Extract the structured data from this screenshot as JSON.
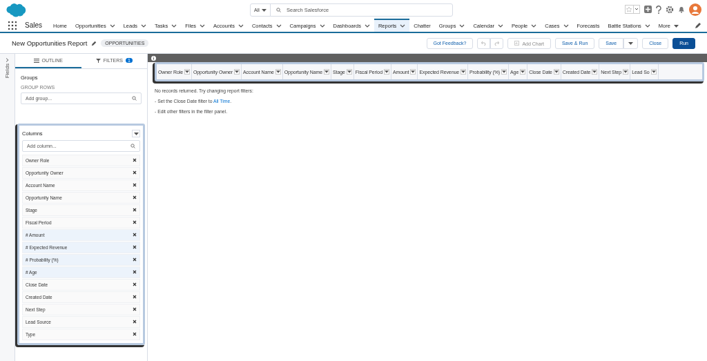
{
  "header": {
    "search_scope": "All",
    "search_placeholder": "Search Salesforce"
  },
  "nav": {
    "app_name": "Sales",
    "items": [
      {
        "label": "Home",
        "menu": false,
        "selected": false
      },
      {
        "label": "Opportunities",
        "menu": true,
        "selected": false
      },
      {
        "label": "Leads",
        "menu": true,
        "selected": false
      },
      {
        "label": "Tasks",
        "menu": true,
        "selected": false
      },
      {
        "label": "Files",
        "menu": true,
        "selected": false
      },
      {
        "label": "Accounts",
        "menu": true,
        "selected": false
      },
      {
        "label": "Contacts",
        "menu": true,
        "selected": false
      },
      {
        "label": "Campaigns",
        "menu": true,
        "selected": false
      },
      {
        "label": "Dashboards",
        "menu": true,
        "selected": false
      },
      {
        "label": "Reports",
        "menu": true,
        "selected": true
      },
      {
        "label": "Chatter",
        "menu": false,
        "selected": false
      },
      {
        "label": "Groups",
        "menu": true,
        "selected": false
      },
      {
        "label": "Calendar",
        "menu": true,
        "selected": false
      },
      {
        "label": "People",
        "menu": true,
        "selected": false
      },
      {
        "label": "Cases",
        "menu": true,
        "selected": false
      },
      {
        "label": "Forecasts",
        "menu": false,
        "selected": false
      },
      {
        "label": "Battle Stations",
        "menu": true,
        "selected": false
      }
    ],
    "more": "More"
  },
  "report": {
    "title": "New Opportunities Report",
    "badge": "OPPORTUNITIES",
    "buttons": [
      {
        "label": "Got Feedback?",
        "disabled": false,
        "primary": false
      },
      {
        "label": "Add Chart",
        "disabled": true,
        "primary": false
      },
      {
        "label": "Save & Run",
        "disabled": false,
        "primary": false
      },
      {
        "label": "Save",
        "disabled": false,
        "primary": false
      },
      {
        "label": "Close",
        "disabled": false,
        "primary": false
      },
      {
        "label": "Run",
        "disabled": false,
        "primary": true
      }
    ]
  },
  "fields_toggle": "Fields",
  "sidebar": {
    "tabs": [
      {
        "label": "OUTLINE",
        "selected": true
      },
      {
        "label": "FILTERS",
        "selected": false,
        "count": "1"
      }
    ],
    "groups_title": "Groups",
    "group_rows_label": "GROUP ROWS",
    "group_placeholder": "Add group...",
    "columns_title": "Columns",
    "column_placeholder": "Add column...",
    "columns": [
      {
        "label": "Owner Role",
        "kind": "text"
      },
      {
        "label": "Opportunity Owner",
        "kind": "text"
      },
      {
        "label": "Account Name",
        "kind": "text"
      },
      {
        "label": "Opportunity Name",
        "kind": "text"
      },
      {
        "label": "Stage",
        "kind": "text"
      },
      {
        "label": "Fiscal Period",
        "kind": "text"
      },
      {
        "label": "# Amount",
        "kind": "number"
      },
      {
        "label": "# Expected Revenue",
        "kind": "number"
      },
      {
        "label": "# Probability (%)",
        "kind": "number"
      },
      {
        "label": "# Age",
        "kind": "number"
      },
      {
        "label": "Close Date",
        "kind": "text"
      },
      {
        "label": "Created Date",
        "kind": "text"
      },
      {
        "label": "Next Step",
        "kind": "text"
      },
      {
        "label": "Lead Source",
        "kind": "text"
      },
      {
        "label": "Type",
        "kind": "text"
      }
    ]
  },
  "table": {
    "columns": [
      {
        "label": "Owner Role"
      },
      {
        "label": "Opportunity Owner"
      },
      {
        "label": "Account Name"
      },
      {
        "label": "Opportunity Name"
      },
      {
        "label": "Stage"
      },
      {
        "label": "Fiscal Period"
      },
      {
        "label": "Amount"
      },
      {
        "label": "Expected Revenue"
      },
      {
        "label": "Probability (%)"
      },
      {
        "label": "Age"
      },
      {
        "label": "Close Date"
      },
      {
        "label": "Created Date"
      },
      {
        "label": "Next Step"
      },
      {
        "label": "Lead So"
      }
    ]
  },
  "empty": {
    "message": "No records returned. Try changing report filters:",
    "hint_before": "- Set the Close Date filter to ",
    "hint_link": "All Time",
    "hint_after": ".",
    "hint2": "- Edit other filters in the filter panel."
  }
}
